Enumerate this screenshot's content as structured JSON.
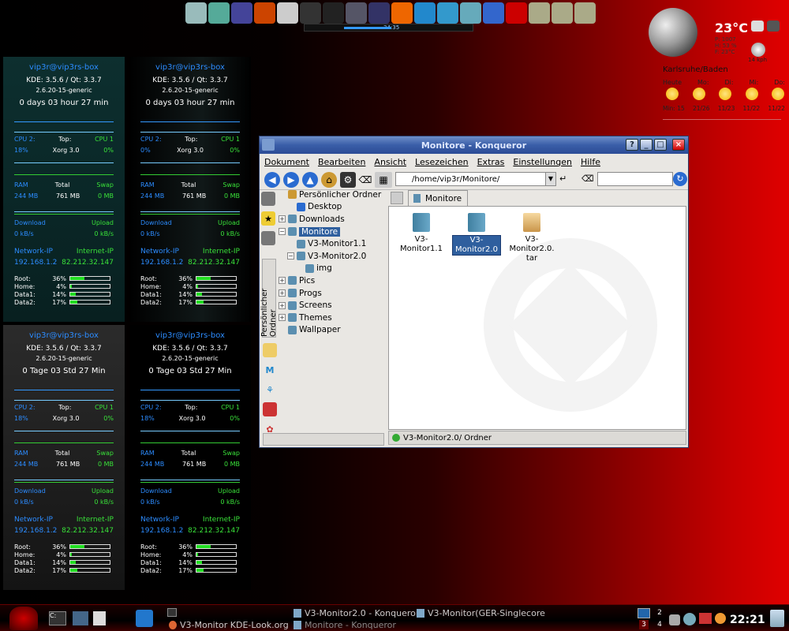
{
  "topbar": {
    "icons": [
      "documents-icon",
      "book-icon",
      "cursor-icon",
      "presentation-icon",
      "magnifier-icon",
      "headphones-icon",
      "film-icon",
      "airplane-icon",
      "tools-icon",
      "firefox-icon",
      "snowflake-icon",
      "cube-icon",
      "users-icon",
      "chat-icon",
      "opera-icon",
      "folder-book-icon",
      "folder-book-icon-2",
      "folder-book-icon-3"
    ],
    "colors": [
      "#9bb",
      "#5a9",
      "#449",
      "#c40",
      "#ccc",
      "#333",
      "#222",
      "#556",
      "#336",
      "#e60",
      "#28c",
      "#39c",
      "#6ab",
      "#36c",
      "#c00",
      "#aa8",
      "#aa8",
      "#aa8"
    ],
    "media_time": "34:35"
  },
  "weather": {
    "temp": "23°C",
    "details": [
      "P: 1007",
      "H: 53 %",
      "F: 23°C"
    ],
    "wind": "14 kph",
    "city": "Karlsruhe/Baden",
    "days": [
      "Heute",
      "Mo:",
      "Di:",
      "Mi:",
      "Do:"
    ],
    "temps": [
      "Min: 15",
      "21/26",
      "11/23",
      "11/22",
      "11/22"
    ]
  },
  "monitors": [
    {
      "host": "vip3r@vip3rs-box",
      "kde": "KDE: 3.5.6  /  Qt: 3.3.7",
      "kernel": "2.6.20-15-generic",
      "uptime": "0 days  03 hour  27 min",
      "cpu_label": "CPU 2:",
      "cpu_val": "18%",
      "top_label": "Top:",
      "top_val": "Xorg 3.0",
      "cpu1_label": "CPU 1",
      "cpu1_val": "0%",
      "ram_label": "RAM",
      "ram_val": "244 MB",
      "total_label": "Total",
      "total_val": "761 MB",
      "swap_label": "Swap",
      "swap_val": "0 MB",
      "down_label": "Download",
      "down_val": "0 kB/s",
      "up_label": "Upload",
      "up_val": "0 kB/s",
      "net_label": "Network-IP",
      "net_val": "192.168.1.2",
      "inet_label": "Internet-IP",
      "inet_val": "82.212.32.147",
      "disks": [
        {
          "name": "Root:",
          "pct": "36%",
          "v": 36
        },
        {
          "name": "Home:",
          "pct": "4%",
          "v": 4
        },
        {
          "name": "Data1:",
          "pct": "14%",
          "v": 14
        },
        {
          "name": "Data2:",
          "pct": "17%",
          "v": 17
        }
      ]
    },
    {
      "host": "vip3r@vip3rs-box",
      "kde": "KDE: 3.5.6  /  Qt: 3.3.7",
      "kernel": "2.6.20-15-generic",
      "uptime": "0 days  03 hour  27 min",
      "cpu_label": "CPU 2:",
      "cpu_val": "0%",
      "top_label": "Top:",
      "top_val": "Xorg 3.0",
      "cpu1_label": "CPU 1",
      "cpu1_val": "0%",
      "ram_label": "RAM",
      "ram_val": "244 MB",
      "total_label": "Total",
      "total_val": "761 MB",
      "swap_label": "Swap",
      "swap_val": "0 MB",
      "down_label": "Download",
      "down_val": "0 kB/s",
      "up_label": "Upload",
      "up_val": "0 kB/s",
      "net_label": "Network-IP",
      "net_val": "192.168.1.2",
      "inet_label": "Internet-IP",
      "inet_val": "82.212.32.147",
      "disks": [
        {
          "name": "Root:",
          "pct": "36%",
          "v": 36
        },
        {
          "name": "Home:",
          "pct": "4%",
          "v": 4
        },
        {
          "name": "Data1:",
          "pct": "14%",
          "v": 14
        },
        {
          "name": "Data2:",
          "pct": "17%",
          "v": 17
        }
      ]
    },
    {
      "host": "vip3r@vip3rs-box",
      "kde": "KDE: 3.5.6  /  Qt: 3.3.7",
      "kernel": "2.6.20-15-generic",
      "uptime": "0 Tage  03 Std   27 Min",
      "cpu_label": "CPU 2:",
      "cpu_val": "18%",
      "top_label": "Top:",
      "top_val": "Xorg 3.0",
      "cpu1_label": "CPU 1",
      "cpu1_val": "0%",
      "ram_label": "RAM",
      "ram_val": "244 MB",
      "total_label": "Total",
      "total_val": "761 MB",
      "swap_label": "Swap",
      "swap_val": "0 MB",
      "down_label": "Download",
      "down_val": "0 kB/s",
      "up_label": "Upload",
      "up_val": "0 kB/s",
      "net_label": "Network-IP",
      "net_val": "192.168.1.2",
      "inet_label": "Internet-IP",
      "inet_val": "82.212.32.147",
      "disks": [
        {
          "name": "Root:",
          "pct": "36%",
          "v": 36
        },
        {
          "name": "Home:",
          "pct": "4%",
          "v": 4
        },
        {
          "name": "Data1:",
          "pct": "14%",
          "v": 14
        },
        {
          "name": "Data2:",
          "pct": "17%",
          "v": 17
        }
      ]
    },
    {
      "host": "vip3r@vip3rs-box",
      "kde": "KDE: 3.5.6  /  Qt: 3.3.7",
      "kernel": "2.6.20-15-generic",
      "uptime": "0 Tage  03 Std   27 Min",
      "cpu_label": "CPU 2:",
      "cpu_val": "18%",
      "top_label": "Top:",
      "top_val": "Xorg 3.0",
      "cpu1_label": "CPU 1",
      "cpu1_val": "0%",
      "ram_label": "RAM",
      "ram_val": "244 MB",
      "total_label": "Total",
      "total_val": "761 MB",
      "swap_label": "Swap",
      "swap_val": "0 MB",
      "down_label": "Download",
      "down_val": "0 kB/s",
      "up_label": "Upload",
      "up_val": "0 kB/s",
      "net_label": "Network-IP",
      "net_val": "192.168.1.2",
      "inet_label": "Internet-IP",
      "inet_val": "82.212.32.147",
      "disks": [
        {
          "name": "Root:",
          "pct": "36%",
          "v": 36
        },
        {
          "name": "Home:",
          "pct": "4%",
          "v": 4
        },
        {
          "name": "Data1:",
          "pct": "14%",
          "v": 14
        },
        {
          "name": "Data2:",
          "pct": "17%",
          "v": 17
        }
      ]
    }
  ],
  "konqueror": {
    "title": "Monitore - Konqueror",
    "menu": [
      "Dokument",
      "Bearbeiten",
      "Ansicht",
      "Lesezeichen",
      "Extras",
      "Einstellungen",
      "Hilfe"
    ],
    "url": "/home/vip3r/Monitore/",
    "sidebar_label": "Persönlicher Ordner",
    "tree": [
      {
        "label": "Persönlicher Ordner",
        "indent": 0,
        "exp": "",
        "sel": false
      },
      {
        "label": "Desktop",
        "indent": 1,
        "exp": "",
        "sel": false
      },
      {
        "label": "Downloads",
        "indent": 0,
        "exp": "+",
        "sel": false
      },
      {
        "label": "Monitore",
        "indent": 0,
        "exp": "−",
        "sel": true
      },
      {
        "label": "V3-Monitor1.1",
        "indent": 1,
        "exp": "",
        "sel": false
      },
      {
        "label": "V3-Monitor2.0",
        "indent": 1,
        "exp": "−",
        "sel": false
      },
      {
        "label": "img",
        "indent": 2,
        "exp": "",
        "sel": false
      },
      {
        "label": "Pics",
        "indent": 0,
        "exp": "+",
        "sel": false
      },
      {
        "label": "Progs",
        "indent": 0,
        "exp": "+",
        "sel": false
      },
      {
        "label": "Screens",
        "indent": 0,
        "exp": "+",
        "sel": false
      },
      {
        "label": "Themes",
        "indent": 0,
        "exp": "+",
        "sel": false
      },
      {
        "label": "Wallpaper",
        "indent": 0,
        "exp": "",
        "sel": false
      }
    ],
    "tab_label": "Monitore",
    "files": [
      {
        "l1": "V3-",
        "l2": "Monitor1.1",
        "l3": "",
        "kind": "folder",
        "sel": false
      },
      {
        "l1": "V3-",
        "l2": "Monitor2.0",
        "l3": "",
        "kind": "folder",
        "sel": true
      },
      {
        "l1": "V3-",
        "l2": "Monitor2.0.",
        "l3": "tar",
        "kind": "archive",
        "sel": false
      }
    ],
    "status": "V3-Monitor2.0/  Ordner"
  },
  "taskbar": {
    "tasks": [
      {
        "label": "V3-Monitor2.0 - Konqueror",
        "icon": "folder-icon"
      },
      {
        "label": "V3-Monitor(GER-Singlecore",
        "icon": "folder-icon"
      },
      {
        "label": "V3-Monitor KDE-Look.org",
        "icon": "firefox-icon"
      },
      {
        "label": "Monitore - Konqueror",
        "icon": "folder-icon"
      }
    ],
    "pager": [
      "1",
      "2",
      "3",
      "4"
    ],
    "clock": "22:21"
  }
}
